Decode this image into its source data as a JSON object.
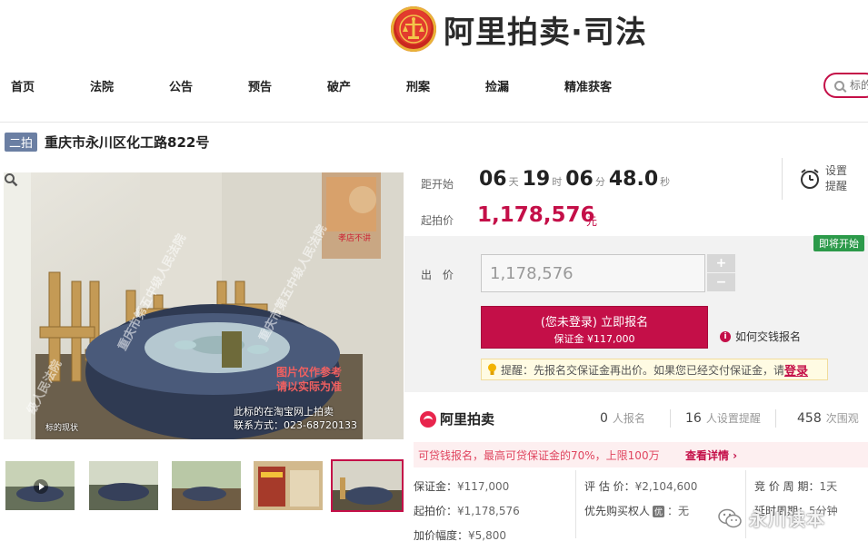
{
  "header": {
    "logo_text": "阿里拍卖·司法"
  },
  "nav": {
    "items": [
      "首页",
      "法院",
      "公告",
      "预告",
      "破产",
      "刑案",
      "捡漏",
      "精准获客"
    ],
    "search_placeholder": "标的"
  },
  "listing": {
    "round_badge": "二拍",
    "title": "重庆市永川区化工路822号"
  },
  "photo": {
    "watermark_lines": [
      "重庆市第五中级人民法院",
      "重庆市第五中级人民法院",
      "级人民法院"
    ],
    "note_line1": "图片仅作参考",
    "note_line2": "请以实际为准",
    "contact_line1": "此标的在淘宝网上拍卖",
    "contact_line2": "联系方式：023-68720133",
    "caption": "标的现状"
  },
  "countdown": {
    "label": "距开始",
    "days": "06",
    "days_unit": "天",
    "hours": "19",
    "hours_unit": "时",
    "minutes": "06",
    "minutes_unit": "分",
    "seconds": "48.0",
    "seconds_unit": "秒",
    "reminder_line1": "设置",
    "reminder_line2": "提醒"
  },
  "pricing": {
    "start_label": "起拍价",
    "start_price": "1,178,576",
    "currency_unit": "元"
  },
  "bid": {
    "status_tag": "即将开始",
    "label": "出 价",
    "value": "1,178,576",
    "plus": "+",
    "minus": "−",
    "signup_line1": "(您未登录) 立即报名",
    "signup_line2": "保证金 ¥117,000",
    "howto_label": "如何交钱报名",
    "tip_text": "提醒：先报名交保证金再出价。如果您已经交付保证金，请",
    "tip_link": "登录"
  },
  "stats": {
    "brand": "阿里拍卖",
    "signups_count": "0",
    "signups_label": "人报名",
    "reminders_count": "16",
    "reminders_label": "人设置提醒",
    "views_count": "458",
    "views_label": "次围观"
  },
  "loan": {
    "text": "可贷钱报名，最高可贷保证金的70%，上限100万",
    "link": "查看详情 ›"
  },
  "details": {
    "deposit_label": "保证金：",
    "deposit_value": "¥117,000",
    "start_label": "起拍价：",
    "start_value": "¥1,178,576",
    "increment_label": "加价幅度：",
    "increment_value": "¥5,800",
    "appraisal_label": "评 估 价：",
    "appraisal_value": "¥2,104,600",
    "priority_label": "优先购买权人",
    "priority_badge": "优",
    "priority_value": "：无",
    "period_label": "竞 价 周 期：",
    "period_value": "1天",
    "extend_label": "延时周期：",
    "extend_value": "5分钟"
  },
  "watermark": {
    "text": "永川读本"
  },
  "colors": {
    "accent": "#c40f48",
    "badge": "#6b7fa3",
    "tag_green": "#2c9a4a"
  }
}
